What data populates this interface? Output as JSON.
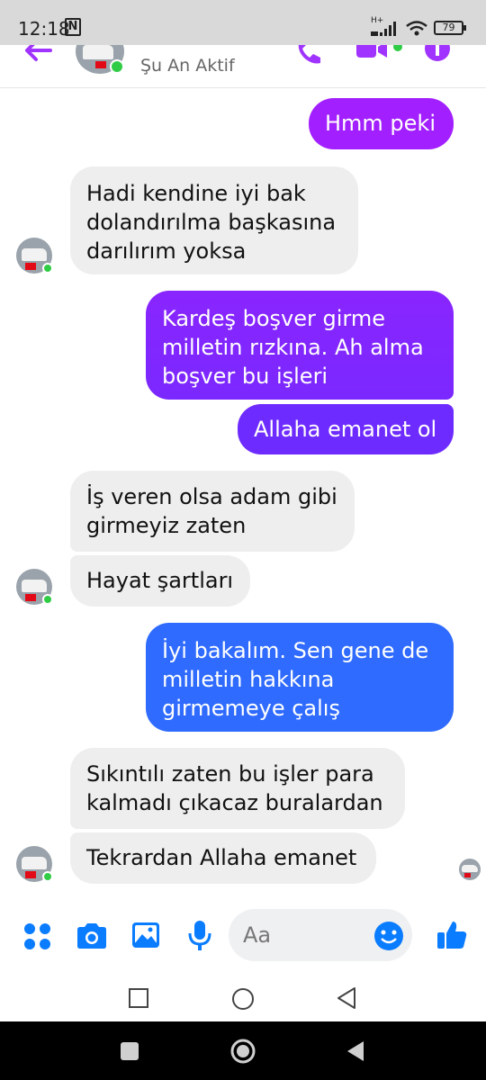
{
  "status_bar": {
    "time": "12:18",
    "nfc": "N",
    "network": "H+",
    "battery": "79"
  },
  "header": {
    "contact_status": "Şu An Aktif"
  },
  "colors": {
    "accent": "#a033ff",
    "outgoing_top": "#a21fff",
    "outgoing_mid": "#6e2bff",
    "outgoing_bottom": "#2f6bff",
    "incoming": "#eeeeee",
    "online": "#31cc46",
    "icon_blue": "#0a7cff"
  },
  "messages": [
    {
      "dir": "out",
      "lines": [
        "Hmm peki"
      ]
    },
    {
      "dir": "in",
      "lines": [
        "Hadi kendine iyi bak",
        "dolandırılma başkasına",
        "darılırım yoksa"
      ]
    },
    {
      "dir": "out",
      "lines": [
        "Kardeş boşver girme",
        "milletin rızkına.  Ah alma",
        "boşver bu işleri"
      ]
    },
    {
      "dir": "out",
      "lines": [
        "Allaha emanet ol"
      ]
    },
    {
      "dir": "in",
      "lines": [
        "İş veren olsa adam gibi",
        "girmeyiz zaten"
      ]
    },
    {
      "dir": "in",
      "lines": [
        "Hayat şartları"
      ]
    },
    {
      "dir": "out",
      "lines": [
        "İyi bakalım. Sen  gene de",
        "milletin hakkına",
        "girmemeye çalış"
      ]
    },
    {
      "dir": "in",
      "lines": [
        "Sıkıntılı zaten bu işler para",
        "kalmadı çıkacaz buralardan"
      ]
    },
    {
      "dir": "in",
      "lines": [
        "Tekrardan Allaha emanet"
      ]
    }
  ],
  "composer": {
    "placeholder": "Aa",
    "icons": [
      "menu-dots-icon",
      "camera-icon",
      "gallery-icon",
      "microphone-icon",
      "emoji-icon",
      "thumbs-up-icon"
    ]
  },
  "nav_icons": [
    "recents-icon",
    "home-icon",
    "back-icon"
  ]
}
